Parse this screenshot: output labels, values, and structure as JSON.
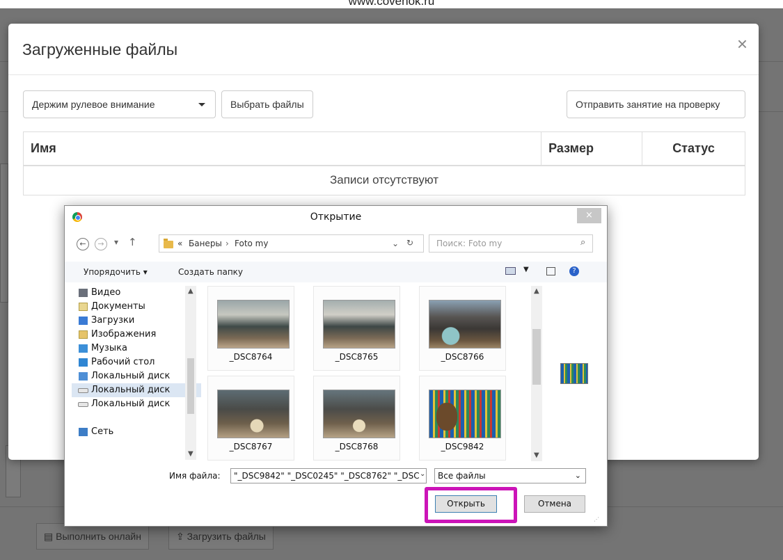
{
  "watermark": "www.covenok.ru",
  "modal": {
    "title": "Загруженные файлы",
    "close": "×",
    "lesson_select": "Держим рулевое внимание",
    "choose_files": "Выбрать файлы",
    "submit": "Отправить занятие на проверку",
    "table": {
      "columns": [
        "Имя",
        "Размер",
        "Статус"
      ],
      "empty": "Записи отсутствуют"
    }
  },
  "background": {
    "run_online": "Выполнить онлайн",
    "upload_files": "Загрузить файлы"
  },
  "dialog": {
    "title": "Открытие",
    "close": "×",
    "breadcrumb": [
      "«",
      "Банеры",
      "›",
      "Foto my"
    ],
    "search_placeholder": "Поиск: Foto my",
    "toolbar": {
      "organize": "Упорядочить ▾",
      "new_folder": "Создать папку"
    },
    "tree": [
      "Видео",
      "Документы",
      "Загрузки",
      "Изображения",
      "Музыка",
      "Рабочий стол",
      "Локальный диск",
      "Локальный диск",
      "Локальный диск",
      "",
      "Сеть"
    ],
    "files": [
      "_DSC8764",
      "_DSC8765",
      "_DSC8766",
      "_DSC8767",
      "_DSC8768",
      "_DSC9842"
    ],
    "filename_label": "Имя файла:",
    "filename_value": "\"_DSC9842\" \"_DSC0245\" \"_DSC8762\" \"_DSC",
    "filter": "Все файлы",
    "open": "Открыть",
    "cancel": "Отмена"
  },
  "colors": {
    "highlight": "#cc14b8",
    "overlay": "rgba(0,0,0,0.5)"
  }
}
